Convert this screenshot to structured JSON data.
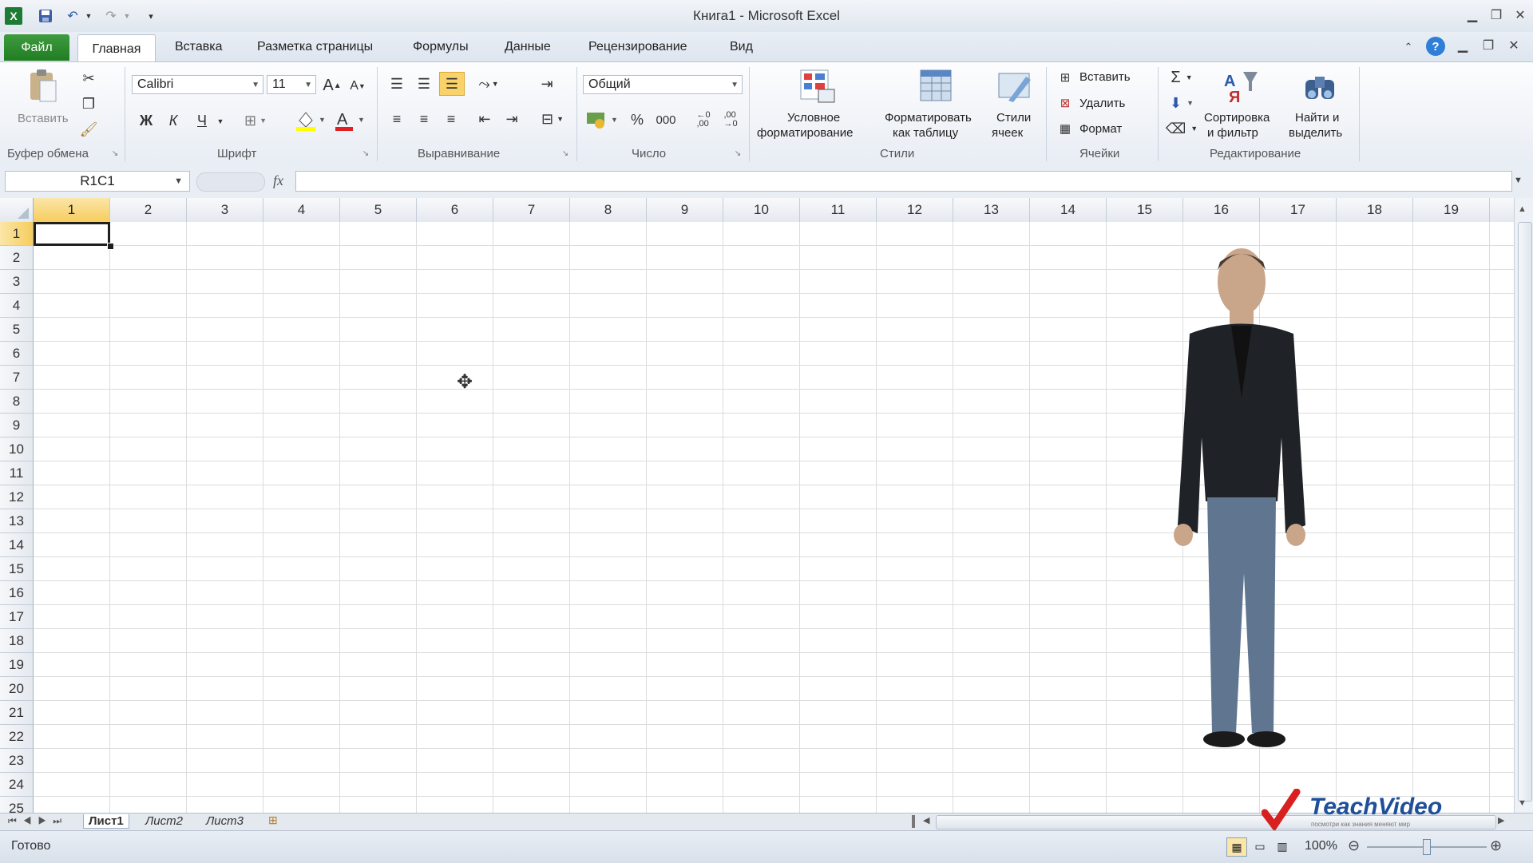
{
  "window": {
    "title": "Книга1 - Microsoft Excel"
  },
  "quick_access": {
    "icons": [
      "excel-logo-icon",
      "save-icon",
      "undo-icon",
      "redo-icon",
      "customize-icon"
    ]
  },
  "tabs": [
    {
      "label": "Файл"
    },
    {
      "label": "Главная"
    },
    {
      "label": "Вставка"
    },
    {
      "label": "Разметка страницы"
    },
    {
      "label": "Формулы"
    },
    {
      "label": "Данные"
    },
    {
      "label": "Рецензирование"
    },
    {
      "label": "Вид"
    }
  ],
  "ribbon": {
    "clipboard": {
      "label": "Буфер обмена",
      "paste": "Вставить"
    },
    "font": {
      "label": "Шрифт",
      "name": "Calibri",
      "size": "11",
      "bold": "Ж",
      "italic": "К",
      "underline": "Ч"
    },
    "alignment": {
      "label": "Выравнивание"
    },
    "number": {
      "label": "Число",
      "format": "Общий",
      "percent": "%",
      "thousands": "000"
    },
    "styles": {
      "label": "Стили",
      "conditional_line1": "Условное",
      "conditional_line2": "форматирование",
      "table_line1": "Форматировать",
      "table_line2": "как таблицу",
      "cellstyles_line1": "Стили",
      "cellstyles_line2": "ячеек"
    },
    "cells": {
      "label": "Ячейки",
      "insert": "Вставить",
      "delete": "Удалить",
      "format": "Формат"
    },
    "editing": {
      "label": "Редактирование",
      "sort_line1": "Сортировка",
      "sort_line2": "и фильтр",
      "find_line1": "Найти и",
      "find_line2": "выделить"
    }
  },
  "formula_bar": {
    "name_box": "R1C1",
    "fx": "fx",
    "value": ""
  },
  "grid": {
    "columns": [
      "1",
      "2",
      "3",
      "4",
      "5",
      "6",
      "7",
      "8",
      "9",
      "10",
      "11",
      "12",
      "13",
      "14",
      "15",
      "16",
      "17",
      "18",
      "19"
    ],
    "rows": [
      "1",
      "2",
      "3",
      "4",
      "5",
      "6",
      "7",
      "8",
      "9",
      "10",
      "11",
      "12",
      "13",
      "14",
      "15",
      "16",
      "17",
      "18",
      "19",
      "20",
      "21",
      "22",
      "23",
      "24",
      "25"
    ],
    "selected_cell": "R1C1"
  },
  "sheets": [
    "Лист1",
    "Лист2",
    "Лист3"
  ],
  "status": {
    "ready": "Готово",
    "zoom": "100%"
  },
  "logo": {
    "text": "TeachVideo",
    "tagline": "посмотри как знания меняют мир"
  },
  "colors": {
    "accent_green": "#217d21",
    "selection": "#f6cd5d"
  }
}
